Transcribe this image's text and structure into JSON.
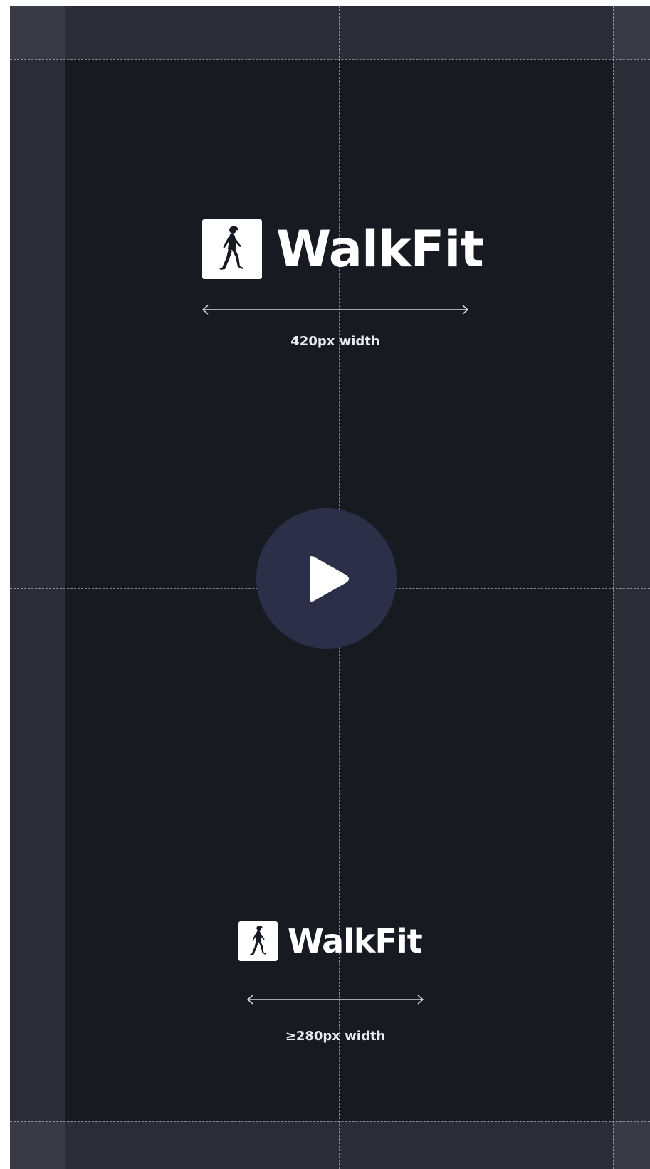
{
  "brand": {
    "name": "WalkFit",
    "logo_icon": "walking-woman-icon"
  },
  "specs": {
    "large_width_label": "420px width",
    "small_width_label": "≥280px width"
  },
  "player": {
    "play_icon": "play-icon"
  },
  "colors": {
    "background": "#181a22",
    "margin_zone": "#2a2d36",
    "play_button": "#2b3048",
    "logo_white": "#ffffff"
  }
}
